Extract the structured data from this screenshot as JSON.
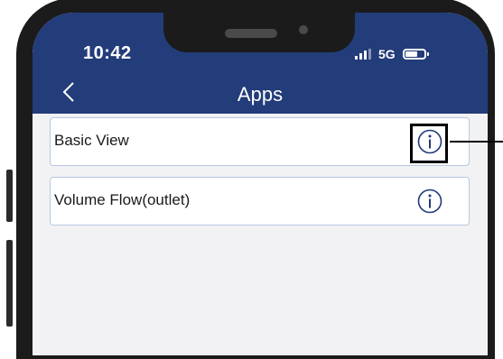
{
  "status_bar": {
    "time": "10:42",
    "network": "5G",
    "signal_icon": "signal-bars-icon",
    "battery_icon": "battery-icon"
  },
  "header": {
    "back_icon": "chevron-left-icon",
    "title": "Apps",
    "background": "#233c7a"
  },
  "apps": [
    {
      "label": "Basic View",
      "info_icon": "info-circle-icon"
    },
    {
      "label": "Volume Flow(outlet)",
      "info_icon": "info-circle-icon"
    }
  ],
  "colors": {
    "header": "#233c7a",
    "list_background": "#f2f2f4",
    "item_border": "#b9c8e2",
    "icon": "#1e3a78"
  }
}
